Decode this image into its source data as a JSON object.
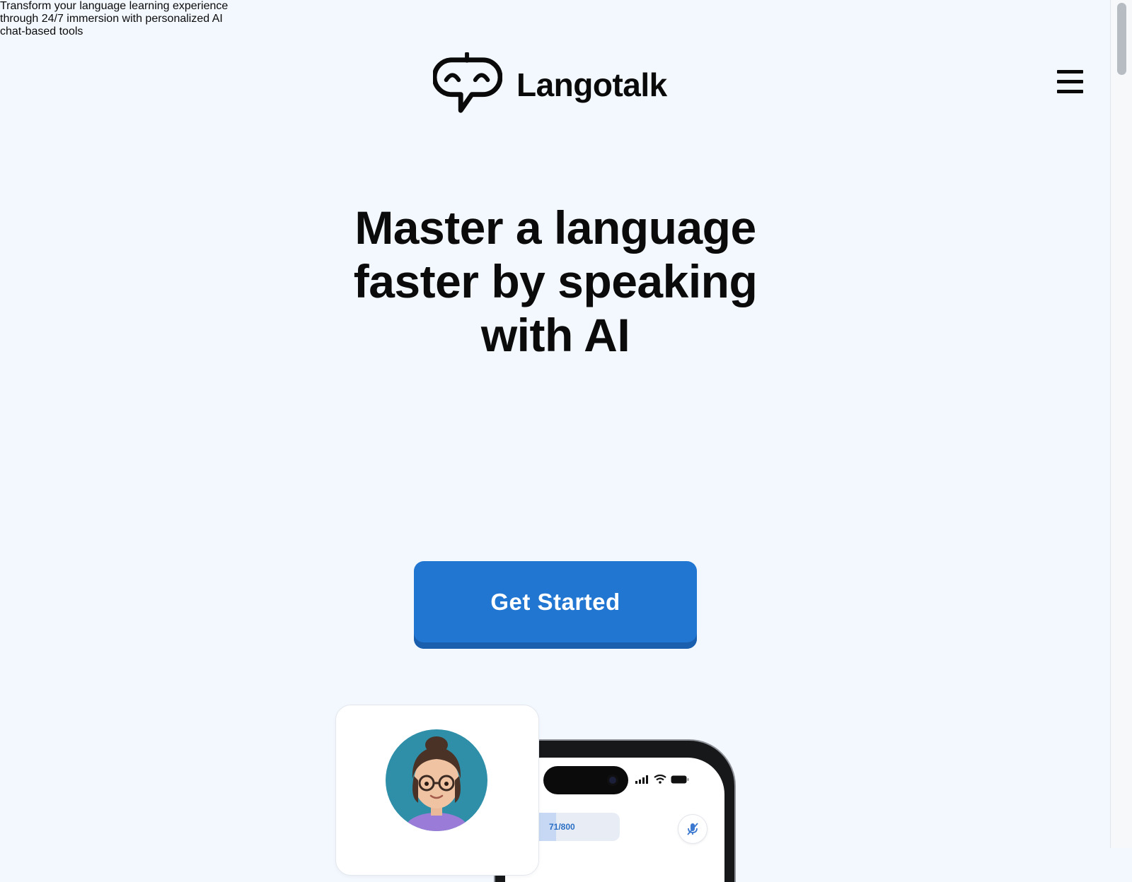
{
  "header": {
    "brand_name": "Langotalk",
    "logo_icon": "speech-bubble-face-icon",
    "menu_icon": "hamburger-menu-icon"
  },
  "hero": {
    "title_lines": [
      "Master a language",
      "faster by speaking",
      "with AI"
    ],
    "subtitle_lines": [
      "Transform your language learning experience",
      "through 24/7 immersion with personalized AI",
      "chat-based tools"
    ],
    "cta_label": "Get Started"
  },
  "app_preview": {
    "counter_text": "71/800",
    "status_icons": [
      "signal-icon",
      "wifi-icon",
      "battery-icon"
    ],
    "mute_icon": "microphone-muted-icon",
    "avatar_icon": "tutor-avatar"
  },
  "colors": {
    "background": "#f3f8fe",
    "brand_blue": "#2176d2",
    "text": "#0b0b0b"
  }
}
